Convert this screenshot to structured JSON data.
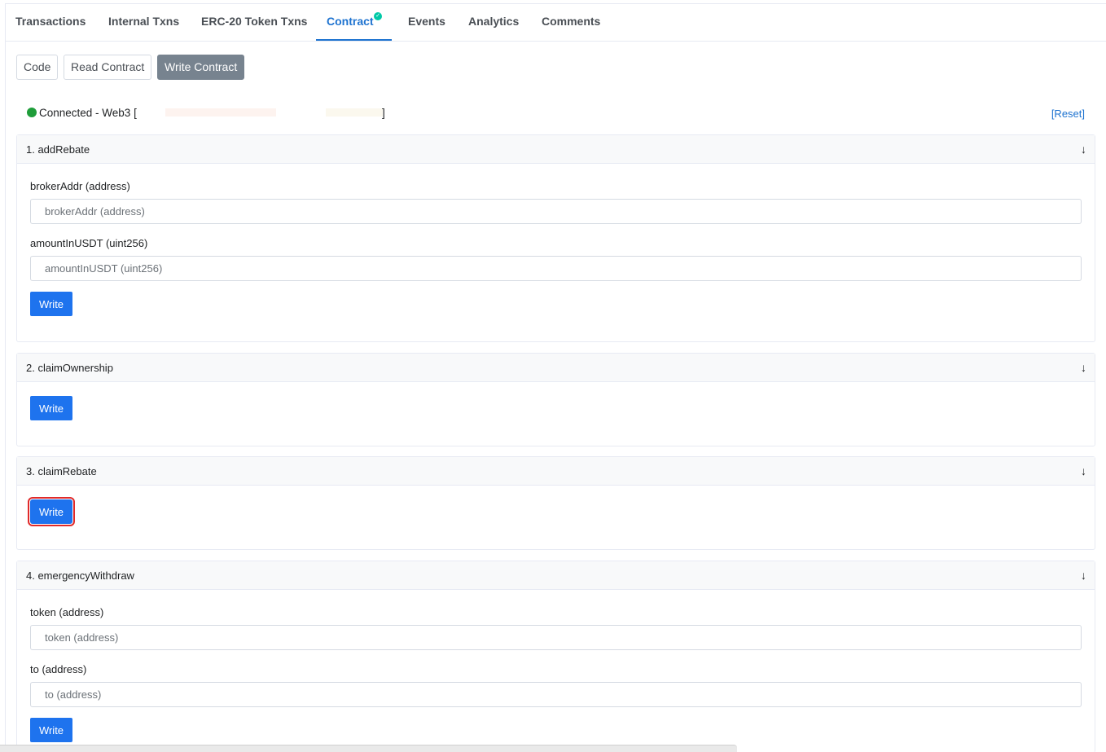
{
  "tabs": [
    {
      "label": "Transactions"
    },
    {
      "label": "Internal Txns"
    },
    {
      "label": "ERC-20 Token Txns"
    },
    {
      "label": "Contract",
      "active": true,
      "verified": true
    },
    {
      "label": "Events"
    },
    {
      "label": "Analytics"
    },
    {
      "label": "Comments"
    }
  ],
  "subtabs": [
    {
      "label": "Code"
    },
    {
      "label": "Read Contract"
    },
    {
      "label": "Write Contract",
      "active": true
    }
  ],
  "connection": {
    "status_text": "Connected - Web3 [",
    "close_bracket": "]",
    "reset_label": "[Reset]",
    "status_color": "#1f9d3a"
  },
  "functions": [
    {
      "title": "1. addRebate",
      "inputs": [
        {
          "label": "brokerAddr (address)",
          "placeholder": "brokerAddr (address)"
        },
        {
          "label": "amountInUSDT (uint256)",
          "placeholder": "amountInUSDT (uint256)"
        }
      ],
      "button": "Write"
    },
    {
      "title": "2. claimOwnership",
      "inputs": [],
      "button": "Write"
    },
    {
      "title": "3. claimRebate",
      "inputs": [],
      "button": "Write",
      "highlighted": true
    },
    {
      "title": "4. emergencyWithdraw",
      "inputs": [
        {
          "label": "token (address)",
          "placeholder": "token (address)"
        },
        {
          "label": "to (address)",
          "placeholder": "to (address)"
        }
      ],
      "button": "Write"
    }
  ],
  "icons": {
    "expand": "arrow-down-icon",
    "verified": "check-circle-icon",
    "status": "status-dot-icon"
  },
  "colors": {
    "accent": "#1e73d0",
    "button": "#1e73ee",
    "highlight": "#e02a2a"
  }
}
